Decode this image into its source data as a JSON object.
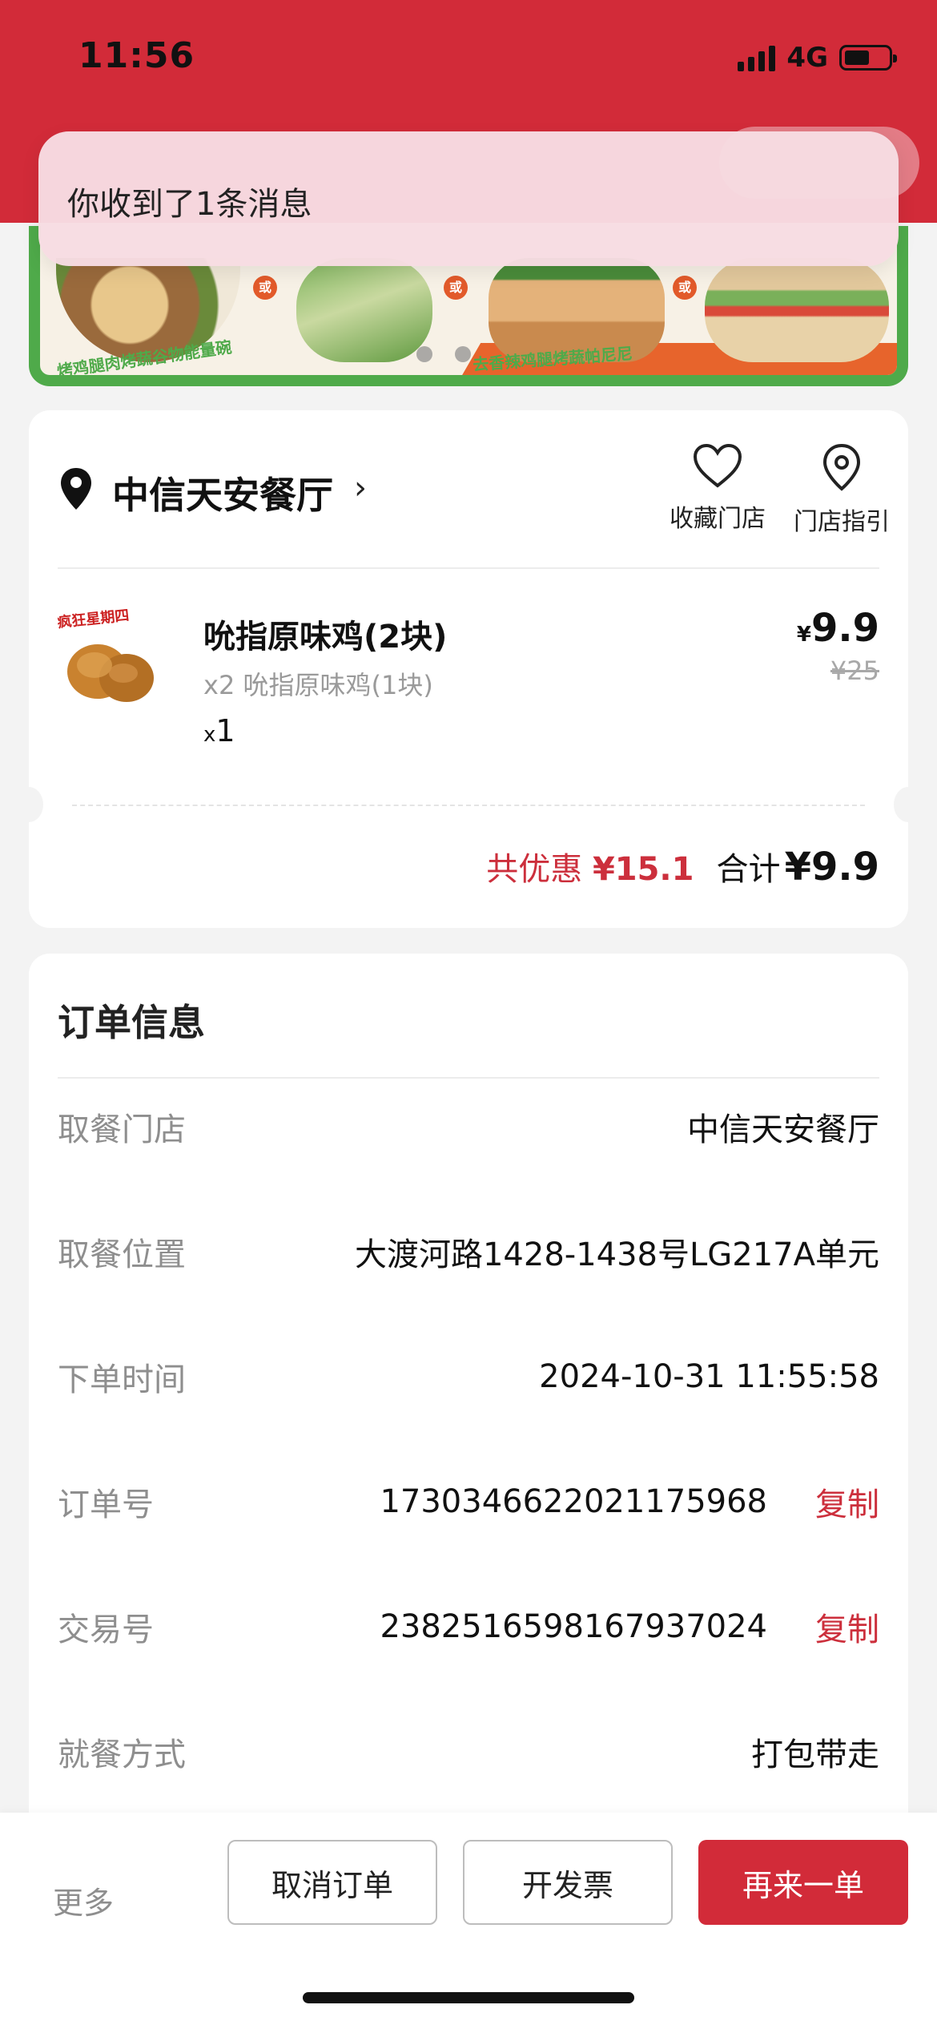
{
  "status_bar": {
    "time": "11:56",
    "network": "4G"
  },
  "notification": {
    "text": "你收到了1条消息"
  },
  "banner": {
    "captions": [
      "烤鸡腿肉烤蔬谷物能量碗",
      "去香辣鸡腿烤蔬帕尼尼"
    ],
    "or_label": "或"
  },
  "store": {
    "name": "中信天安餐厅",
    "favorite_label": "收藏门店",
    "guide_label": "门店指引"
  },
  "item": {
    "name": "吮指原味鸡(2块)",
    "detail": "x2 吮指原味鸡(1块)",
    "qty_prefix": "x",
    "qty": "1",
    "currency": "¥",
    "price": "9.9",
    "original_price": "¥25"
  },
  "totals": {
    "discount_label": "共优惠",
    "discount_value": "¥15.1",
    "sum_label": "合计",
    "sum_value": "¥9.9"
  },
  "order_info": {
    "title": "订单信息",
    "rows": [
      {
        "label": "取餐门店",
        "value": "中信天安餐厅"
      },
      {
        "label": "取餐位置",
        "value": "大渡河路1428-1438号LG217A单元"
      },
      {
        "label": "下单时间",
        "value": "2024-10-31 11:55:58"
      },
      {
        "label": "订单号",
        "value": "1730346622021175968",
        "action": "复制"
      },
      {
        "label": "交易号",
        "value": "2382516598167937024",
        "action": "复制"
      },
      {
        "label": "就餐方式",
        "value": "打包带走"
      }
    ]
  },
  "bottom_bar": {
    "more": "更多",
    "cancel": "取消订单",
    "invoice": "开发票",
    "reorder": "再来一单"
  },
  "colors": {
    "brand_red": "#d22b39",
    "accent_red": "#cc2f3c",
    "banner_green": "#4faa4a"
  }
}
